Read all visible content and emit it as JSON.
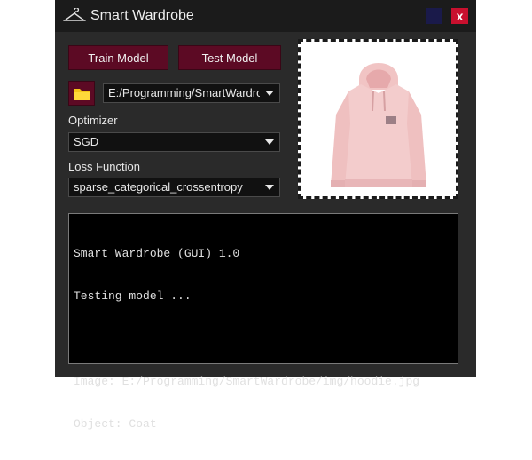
{
  "window": {
    "title": "Smart Wardrobe",
    "min_label": "_",
    "close_label": "x"
  },
  "toolbar": {
    "train_label": "Train Model",
    "test_label": "Test Model"
  },
  "path": {
    "value": "E:/Programming/SmartWardrobe"
  },
  "optimizer": {
    "label": "Optimizer",
    "value": "SGD"
  },
  "loss": {
    "label": "Loss Function",
    "value": "sparse_categorical_crossentropy"
  },
  "preview": {
    "subject": "hoodie",
    "color": "#f3cccc"
  },
  "console": {
    "lines": [
      "Smart Wardrobe (GUI) 1.0",
      "Testing model ...",
      "",
      "Image: E:/Programming/SmartWardrobe/img/hoodie.jpg",
      "Object: Coat"
    ]
  },
  "colors": {
    "accent": "#5c0a24",
    "close": "#c8102e",
    "minimize": "#1a1a4a"
  }
}
